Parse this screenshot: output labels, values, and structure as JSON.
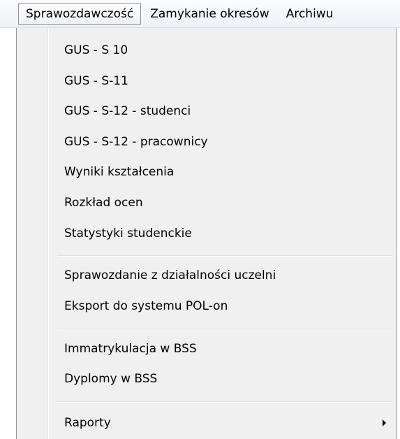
{
  "menubar": {
    "items": [
      {
        "label": "Sprawozdawczość"
      },
      {
        "label": "Zamykanie okresów"
      },
      {
        "label": "Archiwu"
      }
    ]
  },
  "dropdown": {
    "items": [
      {
        "label": "GUS - S 10"
      },
      {
        "label": "GUS - S-11"
      },
      {
        "label": "GUS - S-12 - studenci"
      },
      {
        "label": "GUS - S-12 - pracownicy"
      },
      {
        "label": "Wyniki kształcenia"
      },
      {
        "label": "Rozkład ocen"
      },
      {
        "label": "Statystyki studenckie"
      },
      {
        "label": "Sprawozdanie z działalności uczelni"
      },
      {
        "label": "Eksport do systemu POL-on"
      },
      {
        "label": "Immatrykulacja w BSS"
      },
      {
        "label": "Dyplomy w BSS"
      },
      {
        "label": "Raporty"
      }
    ],
    "submenu_arrow_icon": "chevron-right-icon"
  }
}
